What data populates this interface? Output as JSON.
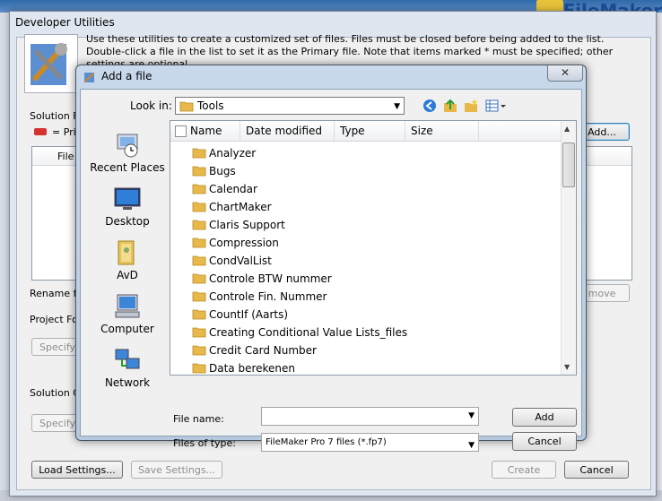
{
  "background": {
    "brand_text": "FileMaker"
  },
  "dev_utilities": {
    "title": "Developer Utilities",
    "intro": "Use these utilities to create a customized set of files. Files must be closed before being added to the list. Double-click a file in the list to set it as the Primary file. Note that items marked * must be specified; other settings are optional.",
    "solution_files_label": "Solution Fi",
    "primary_label": "= Pri",
    "file_col": "File",
    "add_button": "Add...",
    "rename_label": "Rename fi",
    "remove_button": "move",
    "project_folder_label": "Project Fo",
    "specify_button_1": "Specify",
    "solution_options_label": "Solution O",
    "specify_button_2": "Specify",
    "load_settings": "Load Settings...",
    "save_settings": "Save Settings...",
    "create": "Create",
    "cancel": "Cancel"
  },
  "dialog": {
    "title": "Add a file",
    "close_glyph": "✕",
    "look_in_label": "Look in:",
    "look_in_value": "Tools",
    "places": [
      {
        "label": "Recent Places",
        "icon": "recent-places-icon"
      },
      {
        "label": "Desktop",
        "icon": "desktop-icon"
      },
      {
        "label": "AvD",
        "icon": "user-folder-icon"
      },
      {
        "label": "Computer",
        "icon": "computer-icon"
      },
      {
        "label": "Network",
        "icon": "network-icon"
      }
    ],
    "columns": {
      "name": "Name",
      "date": "Date modified",
      "type": "Type",
      "size": "Size"
    },
    "files": [
      "Analyzer",
      "Bugs",
      "Calendar",
      "ChartMaker",
      "Claris Support",
      "Compression",
      "CondValList",
      "Controle BTW nummer",
      "Controle Fin. Nummer",
      "CountIf (Aarts)",
      "Creating Conditional Value Lists_files",
      "Credit Card Number",
      "Data berekenen"
    ],
    "file_name_label": "File name:",
    "file_name_value": "",
    "files_of_type_label": "Files of type:",
    "files_of_type_value": "FileMaker Pro 7 files (*.fp7)",
    "add_button": "Add",
    "cancel_button": "Cancel"
  }
}
